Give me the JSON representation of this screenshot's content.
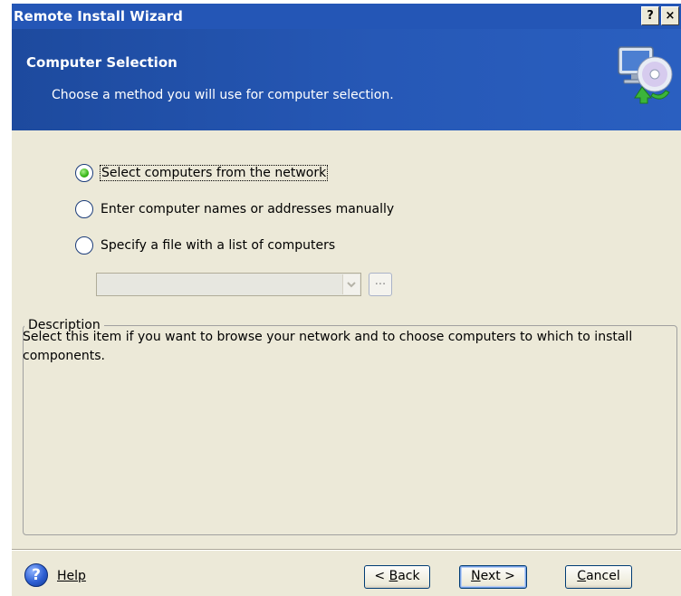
{
  "window": {
    "title": "Remote Install Wizard",
    "help_button": "?",
    "close_button": "×"
  },
  "header": {
    "title": "Computer Selection",
    "subtitle": "Choose a method you will use for computer selection.",
    "icon": "computer-cd-icon"
  },
  "options": [
    {
      "label": "Select computers from the network",
      "checked": true
    },
    {
      "label": "Enter computer names or addresses manually",
      "checked": false
    },
    {
      "label": "Specify a file with a list of computers",
      "checked": false
    }
  ],
  "file_combo": {
    "value": "",
    "enabled": false
  },
  "browse_button": {
    "label": "..."
  },
  "description": {
    "legend": "Description",
    "text": "Select this item if you want to browse your network and to choose computers to which to install components."
  },
  "footer": {
    "help_label": "Help",
    "back": {
      "pre": "< ",
      "mn": "B",
      "post": "ack"
    },
    "next": {
      "pre": "",
      "mn": "N",
      "post": "ext >"
    },
    "cancel": {
      "pre": "",
      "mn": "C",
      "post": "ancel"
    }
  },
  "colors": {
    "titlebar": "#2456b6",
    "header": "#2658b6",
    "dialog_bg": "#ece9d8",
    "radio_checked": "#35b516"
  }
}
